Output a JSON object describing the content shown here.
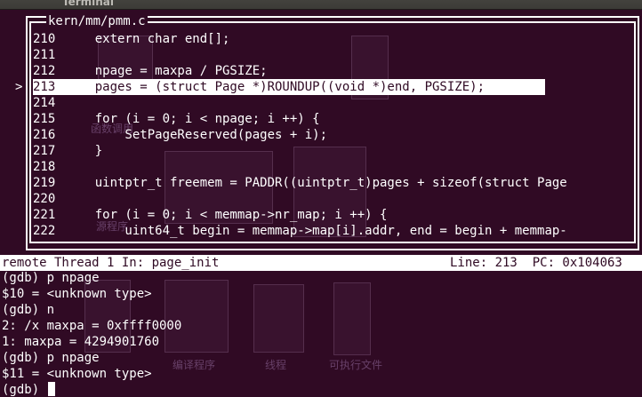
{
  "window": {
    "title": "Terminal"
  },
  "source_view": {
    "file": "kern/mm/pmm.c",
    "current_line_marker": ">",
    "lines": [
      {
        "num": "210",
        "code": "    extern char end[];"
      },
      {
        "num": "211",
        "code": ""
      },
      {
        "num": "212",
        "code": "    npage = maxpa / PGSIZE;"
      },
      {
        "num": "213",
        "code": "    pages = (struct Page *)ROUNDUP((void *)end, PGSIZE);"
      },
      {
        "num": "214",
        "code": ""
      },
      {
        "num": "215",
        "code": "    for (i = 0; i < npage; i ++) {"
      },
      {
        "num": "216",
        "code": "        SetPageReserved(pages + i);"
      },
      {
        "num": "217",
        "code": "    }"
      },
      {
        "num": "218",
        "code": ""
      },
      {
        "num": "219",
        "code": "    uintptr_t freemem = PADDR((uintptr_t)pages + sizeof(struct Page"
      },
      {
        "num": "220",
        "code": ""
      },
      {
        "num": "221",
        "code": "    for (i = 0; i < memmap->nr_map; i ++) {"
      },
      {
        "num": "222",
        "code": "        uint64_t begin = memmap->map[i].addr, end = begin + memmap-"
      }
    ],
    "current_index": 3
  },
  "status": {
    "left": "remote Thread 1 In: page_init",
    "right": "Line: 213  PC: 0x104063"
  },
  "console": {
    "lines": [
      "(gdb) p npage",
      "$10 = <unknown type>",
      "(gdb) n",
      "2: /x maxpa = 0xffff0000",
      "1: maxpa = 4294901760",
      "(gdb) p npage",
      "$11 = <unknown type>"
    ],
    "prompt": "(gdb) "
  },
  "background_ghost": {
    "labels": [
      "函数调用",
      "源程序",
      "编译程序",
      "线程",
      "可执行文件"
    ]
  }
}
